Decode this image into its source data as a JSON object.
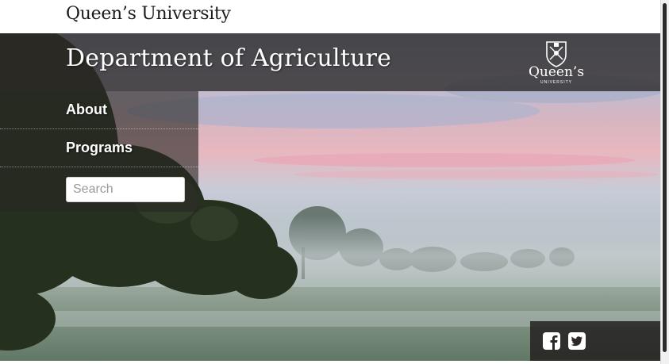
{
  "university": {
    "wordmark": "Queen’s University"
  },
  "header": {
    "site_title": "Department of Agriculture",
    "logo_text": "Queen’s",
    "logo_subtext": "UNIVERSITY"
  },
  "nav": {
    "items": [
      {
        "label": "About"
      },
      {
        "label": "Programs"
      }
    ],
    "search": {
      "placeholder": "Search",
      "value": ""
    }
  },
  "social": {
    "icons": [
      "facebook-icon",
      "twitter-icon"
    ]
  },
  "colors": {
    "header_band": "#2d2826",
    "nav_text": "#ffffff",
    "page_bg": "#ffffff"
  }
}
